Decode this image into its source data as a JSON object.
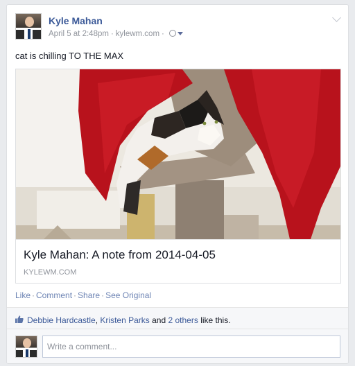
{
  "post": {
    "author": "Kyle Mahan",
    "date": "April 5 at 2:48pm",
    "source": "kylewm.com",
    "separator": "·",
    "status_text": "cat is chilling TO THE MAX",
    "privacy_icon": "globe-icon",
    "menu_icon": "chevron-down-icon"
  },
  "attachment": {
    "image_alt": "cat lying on a carpeted cat tree under a red knitted blanket",
    "title": "Kyle Mahan: A note from 2014-04-05",
    "domain": "KYLEWM.COM"
  },
  "actions": {
    "like": "Like",
    "comment": "Comment",
    "share": "Share",
    "see_original": "See Original",
    "separator": "·"
  },
  "likes": {
    "icon": "thumbs-up-icon",
    "person1": "Debbie Hardcastle",
    "comma": ",",
    "person2": "Kristen Parks",
    "and": "and",
    "others": "2 others",
    "suffix": "like this."
  },
  "comment_box": {
    "placeholder": "Write a comment..."
  },
  "colors": {
    "link_blue": "#3b5998",
    "meta_gray": "#90949c",
    "blanket_red": "#b8121c",
    "footer_bg": "#f6f7f9"
  }
}
